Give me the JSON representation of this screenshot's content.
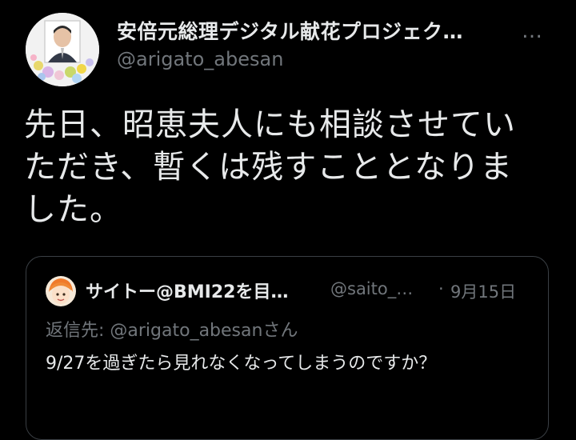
{
  "author": {
    "display_name": "安倍元総理デジタル献花プロジェク…",
    "handle": "@arigato_abesan",
    "avatar_icon": "memorial-portrait-avatar"
  },
  "more_icon": "…",
  "tweet": {
    "text": "先日、昭恵夫人にも相談させていただき、暫くは残すこととなりました。"
  },
  "quote": {
    "display_name": "サイトー@BMI22を目…",
    "handle": "@saito_…",
    "separator": "·",
    "date": "9月15日",
    "reply_to": "返信先: @arigato_abesanさん",
    "text": "9/27を過ぎたら見れなくなってしまうのですか？",
    "avatar_icon": "anime-character-avatar"
  },
  "colors": {
    "background": "#000000",
    "primary_text": "#e7e9ea",
    "secondary_text": "#71767b",
    "border": "#3a3f44"
  }
}
